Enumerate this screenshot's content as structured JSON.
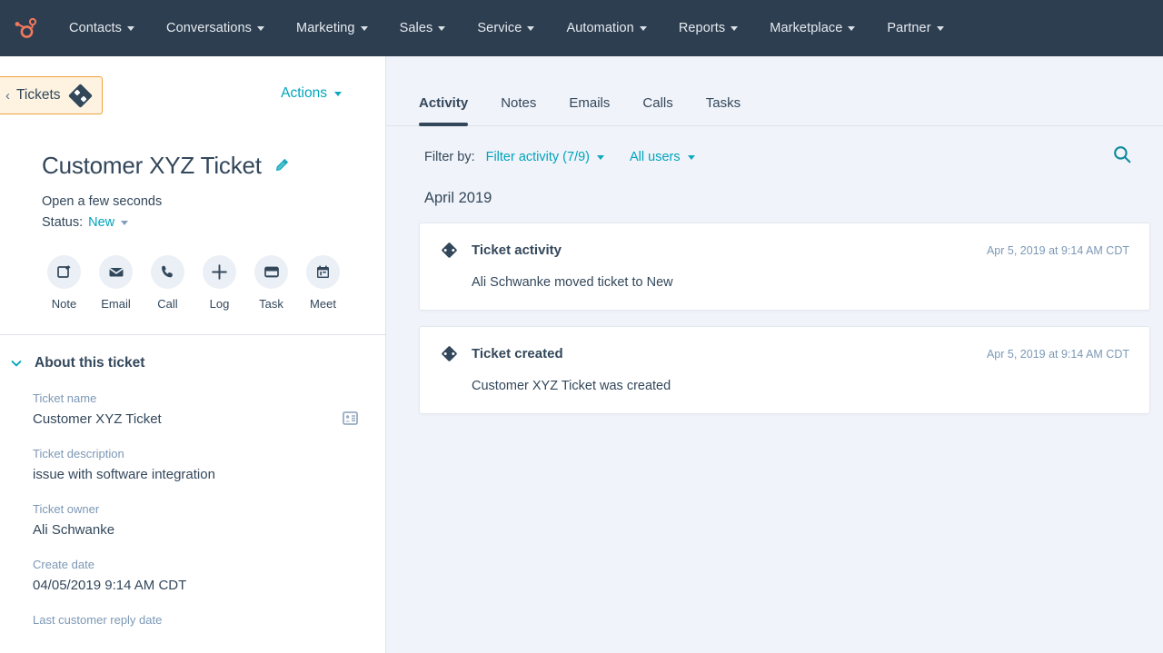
{
  "topnav": {
    "logo_icon": "hubspot-sprocket-logo",
    "logo_color": "#f2785c",
    "background": "#2d3e50",
    "items": [
      {
        "label": "Contacts",
        "caret": true
      },
      {
        "label": "Conversations",
        "caret": true
      },
      {
        "label": "Marketing",
        "caret": true
      },
      {
        "label": "Sales",
        "caret": true
      },
      {
        "label": "Service",
        "caret": true
      },
      {
        "label": "Automation",
        "caret": true
      },
      {
        "label": "Reports",
        "caret": true
      },
      {
        "label": "Marketplace",
        "caret": true
      },
      {
        "label": "Partner",
        "caret": true
      }
    ]
  },
  "sidebar": {
    "back_link": {
      "label": "Tickets",
      "chevron": "‹",
      "icon": "ticket-diamond-icon",
      "highlight_border": "#f0a23c",
      "highlight_bg": "#fdf3e0"
    },
    "actions": {
      "label": "Actions"
    },
    "title": "Customer XYZ Ticket",
    "edit_icon": "pencil-icon",
    "open_status": "Open a few seconds",
    "status_label": "Status:",
    "status_value": "New",
    "quick_actions": [
      {
        "label": "Note",
        "icon": "note-icon"
      },
      {
        "label": "Email",
        "icon": "envelope-icon"
      },
      {
        "label": "Call",
        "icon": "phone-icon"
      },
      {
        "label": "Log",
        "icon": "plus-icon"
      },
      {
        "label": "Task",
        "icon": "task-icon"
      },
      {
        "label": "Meet",
        "icon": "calendar-icon"
      }
    ],
    "about_section": {
      "title": "About this ticket",
      "chevron_icon": "chevron-down-icon",
      "fields": [
        {
          "label": "Ticket name",
          "value": "Customer XYZ Ticket",
          "icon": "contact-card-icon"
        },
        {
          "label": "Ticket description",
          "value": "issue with software integration"
        },
        {
          "label": "Ticket owner",
          "value": "Ali Schwanke"
        },
        {
          "label": "Create date",
          "value": "04/05/2019 9:14 AM CDT"
        },
        {
          "label": "Last customer reply date",
          "value": ""
        }
      ]
    }
  },
  "main": {
    "tabs": [
      {
        "label": "Activity",
        "active": true
      },
      {
        "label": "Notes",
        "active": false
      },
      {
        "label": "Emails",
        "active": false
      },
      {
        "label": "Calls",
        "active": false
      },
      {
        "label": "Tasks",
        "active": false
      }
    ],
    "filter": {
      "label": "Filter by:",
      "activity_filter": "Filter activity (7/9)",
      "user_filter": "All users",
      "search_icon": "search-icon"
    },
    "month_heading": "April 2019",
    "activities": [
      {
        "icon": "ticket-diamond-icon",
        "title": "Ticket activity",
        "timestamp": "Apr 5, 2019 at 9:14 AM CDT",
        "body": "Ali Schwanke moved ticket to New"
      },
      {
        "icon": "ticket-diamond-icon",
        "title": "Ticket created",
        "timestamp": "Apr 5, 2019 at 9:14 AM CDT",
        "body": "Customer XYZ Ticket was created"
      }
    ]
  },
  "colors": {
    "nav_bg": "#2d3e50",
    "accent_teal": "#00a4bd",
    "text_primary": "#33475b",
    "text_muted": "#7c98b6",
    "page_bg": "#f0f3f9"
  }
}
